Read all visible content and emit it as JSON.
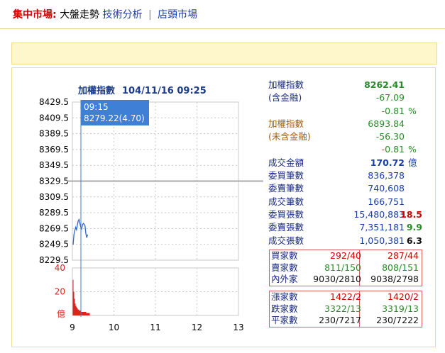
{
  "nav": {
    "lead": "集中市場:",
    "current": "大盤走勢",
    "link_analysis": "技術分析",
    "separator": "|",
    "link_otc": "店頭市場"
  },
  "chart": {
    "title": "加權指數",
    "datetime": "104/11/16 09:25",
    "tooltip_time": "09:15",
    "tooltip_value": "8279.22(4.70)",
    "y_ticks": [
      "8429.5",
      "8409.5",
      "8389.5",
      "8369.5",
      "8349.5",
      "8329.5",
      "8309.5",
      "8289.5",
      "8269.5",
      "8249.5",
      "8229.5"
    ],
    "vol_ticks": [
      "40",
      "20",
      "億"
    ],
    "x_ticks": [
      "9",
      "10",
      "11",
      "12",
      "13"
    ]
  },
  "chart_data": {
    "type": "line",
    "title": "加權指數",
    "ylim": [
      8229.5,
      8429.5
    ],
    "reference_line": 8329.5,
    "x_range": [
      "9",
      "13"
    ],
    "series": [
      {
        "values": [
          8249.0,
          8262.0,
          8267.0,
          8271.0,
          8268.0,
          8274.0,
          8279.2,
          8281.0,
          8276.0,
          8271.0,
          8269.0,
          8274.0,
          8276.0,
          8275.0,
          8273.0,
          8263.0,
          8258.0,
          8262.0
        ]
      }
    ],
    "volume": {
      "ylim": [
        0,
        40
      ],
      "values": [
        30,
        20,
        14,
        10,
        8,
        7,
        6,
        5,
        5,
        4,
        4,
        4,
        3,
        3,
        3,
        3,
        3,
        3,
        3,
        2,
        2,
        2,
        2,
        2
      ]
    }
  },
  "stats": {
    "rows": [
      {
        "label": "加權指數",
        "value": "8262.41",
        "unit": "",
        "extra": "",
        "lblc": "c-navy",
        "valc": "c-green",
        "bold": true
      },
      {
        "label": "(含金融)",
        "value": "-67.09",
        "unit": "",
        "extra": "",
        "lblc": "c-navy",
        "valc": "c-green",
        "bold": false
      },
      {
        "label": "",
        "value": "-0.81",
        "unit": "%",
        "extra": "",
        "lblc": "c-navy",
        "valc": "c-green",
        "bold": false
      },
      {
        "label": "加權指數",
        "value": "6893.84",
        "unit": "",
        "extra": "",
        "lblc": "c-brown",
        "valc": "c-green",
        "bold": false
      },
      {
        "label": "(未含金融)",
        "value": "-56.30",
        "unit": "",
        "extra": "",
        "lblc": "c-brown",
        "valc": "c-green",
        "bold": false
      },
      {
        "label": "",
        "value": "-0.81",
        "unit": "%",
        "extra": "",
        "lblc": "c-brown",
        "valc": "c-green",
        "bold": false
      },
      {
        "label": "成交金額",
        "value": "170.72",
        "unit": "億",
        "extra": "",
        "lblc": "c-navy",
        "valc": "c-blue",
        "bold": true
      },
      {
        "label": "委買筆數",
        "value": "836,378",
        "unit": "",
        "extra": "",
        "lblc": "c-navy",
        "valc": "c-blue",
        "bold": false
      },
      {
        "label": "委賣筆數",
        "value": "740,608",
        "unit": "",
        "extra": "",
        "lblc": "c-navy",
        "valc": "c-blue",
        "bold": false
      },
      {
        "label": "成交筆數",
        "value": "166,751",
        "unit": "",
        "extra": "",
        "lblc": "c-navy",
        "valc": "c-blue",
        "bold": false
      },
      {
        "label": "委買張數",
        "value": "15,480,883",
        "unit": "",
        "extra": "18.5",
        "extc": "c-red",
        "lblc": "c-navy",
        "valc": "c-blue",
        "bold": false
      },
      {
        "label": "委賣張數",
        "value": "7,351,181",
        "unit": "",
        "extra": "9.9",
        "extc": "c-green",
        "lblc": "c-navy",
        "valc": "c-blue",
        "bold": false
      },
      {
        "label": "成交張數",
        "value": "1,050,381",
        "unit": "",
        "extra": "6.3",
        "extc": "c-dark",
        "lblc": "c-navy",
        "valc": "c-blue",
        "bold": false
      }
    ]
  },
  "ratios1": [
    {
      "label": "買家數",
      "c1": "292/40",
      "c2": "287/44",
      "color": "c-red"
    },
    {
      "label": "賣家數",
      "c1": "811/150",
      "c2": "808/151",
      "color": "c-green"
    },
    {
      "label": "內外家",
      "c1": "9030/2810",
      "c2": "9038/2798",
      "color": "c-dark"
    }
  ],
  "ratios2": [
    {
      "label": "漲家數",
      "c1": "1422/2",
      "c2": "1420/2",
      "color": "c-red"
    },
    {
      "label": "跌家數",
      "c1": "3322/13",
      "c2": "3319/13",
      "color": "c-green"
    },
    {
      "label": "平家數",
      "c1": "230/7217",
      "c2": "230/7222",
      "color": "c-dark"
    }
  ],
  "colors": {
    "price_line": "#3366cc",
    "volume": "#dd2222",
    "reference": "#aaaaaa",
    "crosshair": "#3f7fd6",
    "grid": "#c8c8c8"
  }
}
